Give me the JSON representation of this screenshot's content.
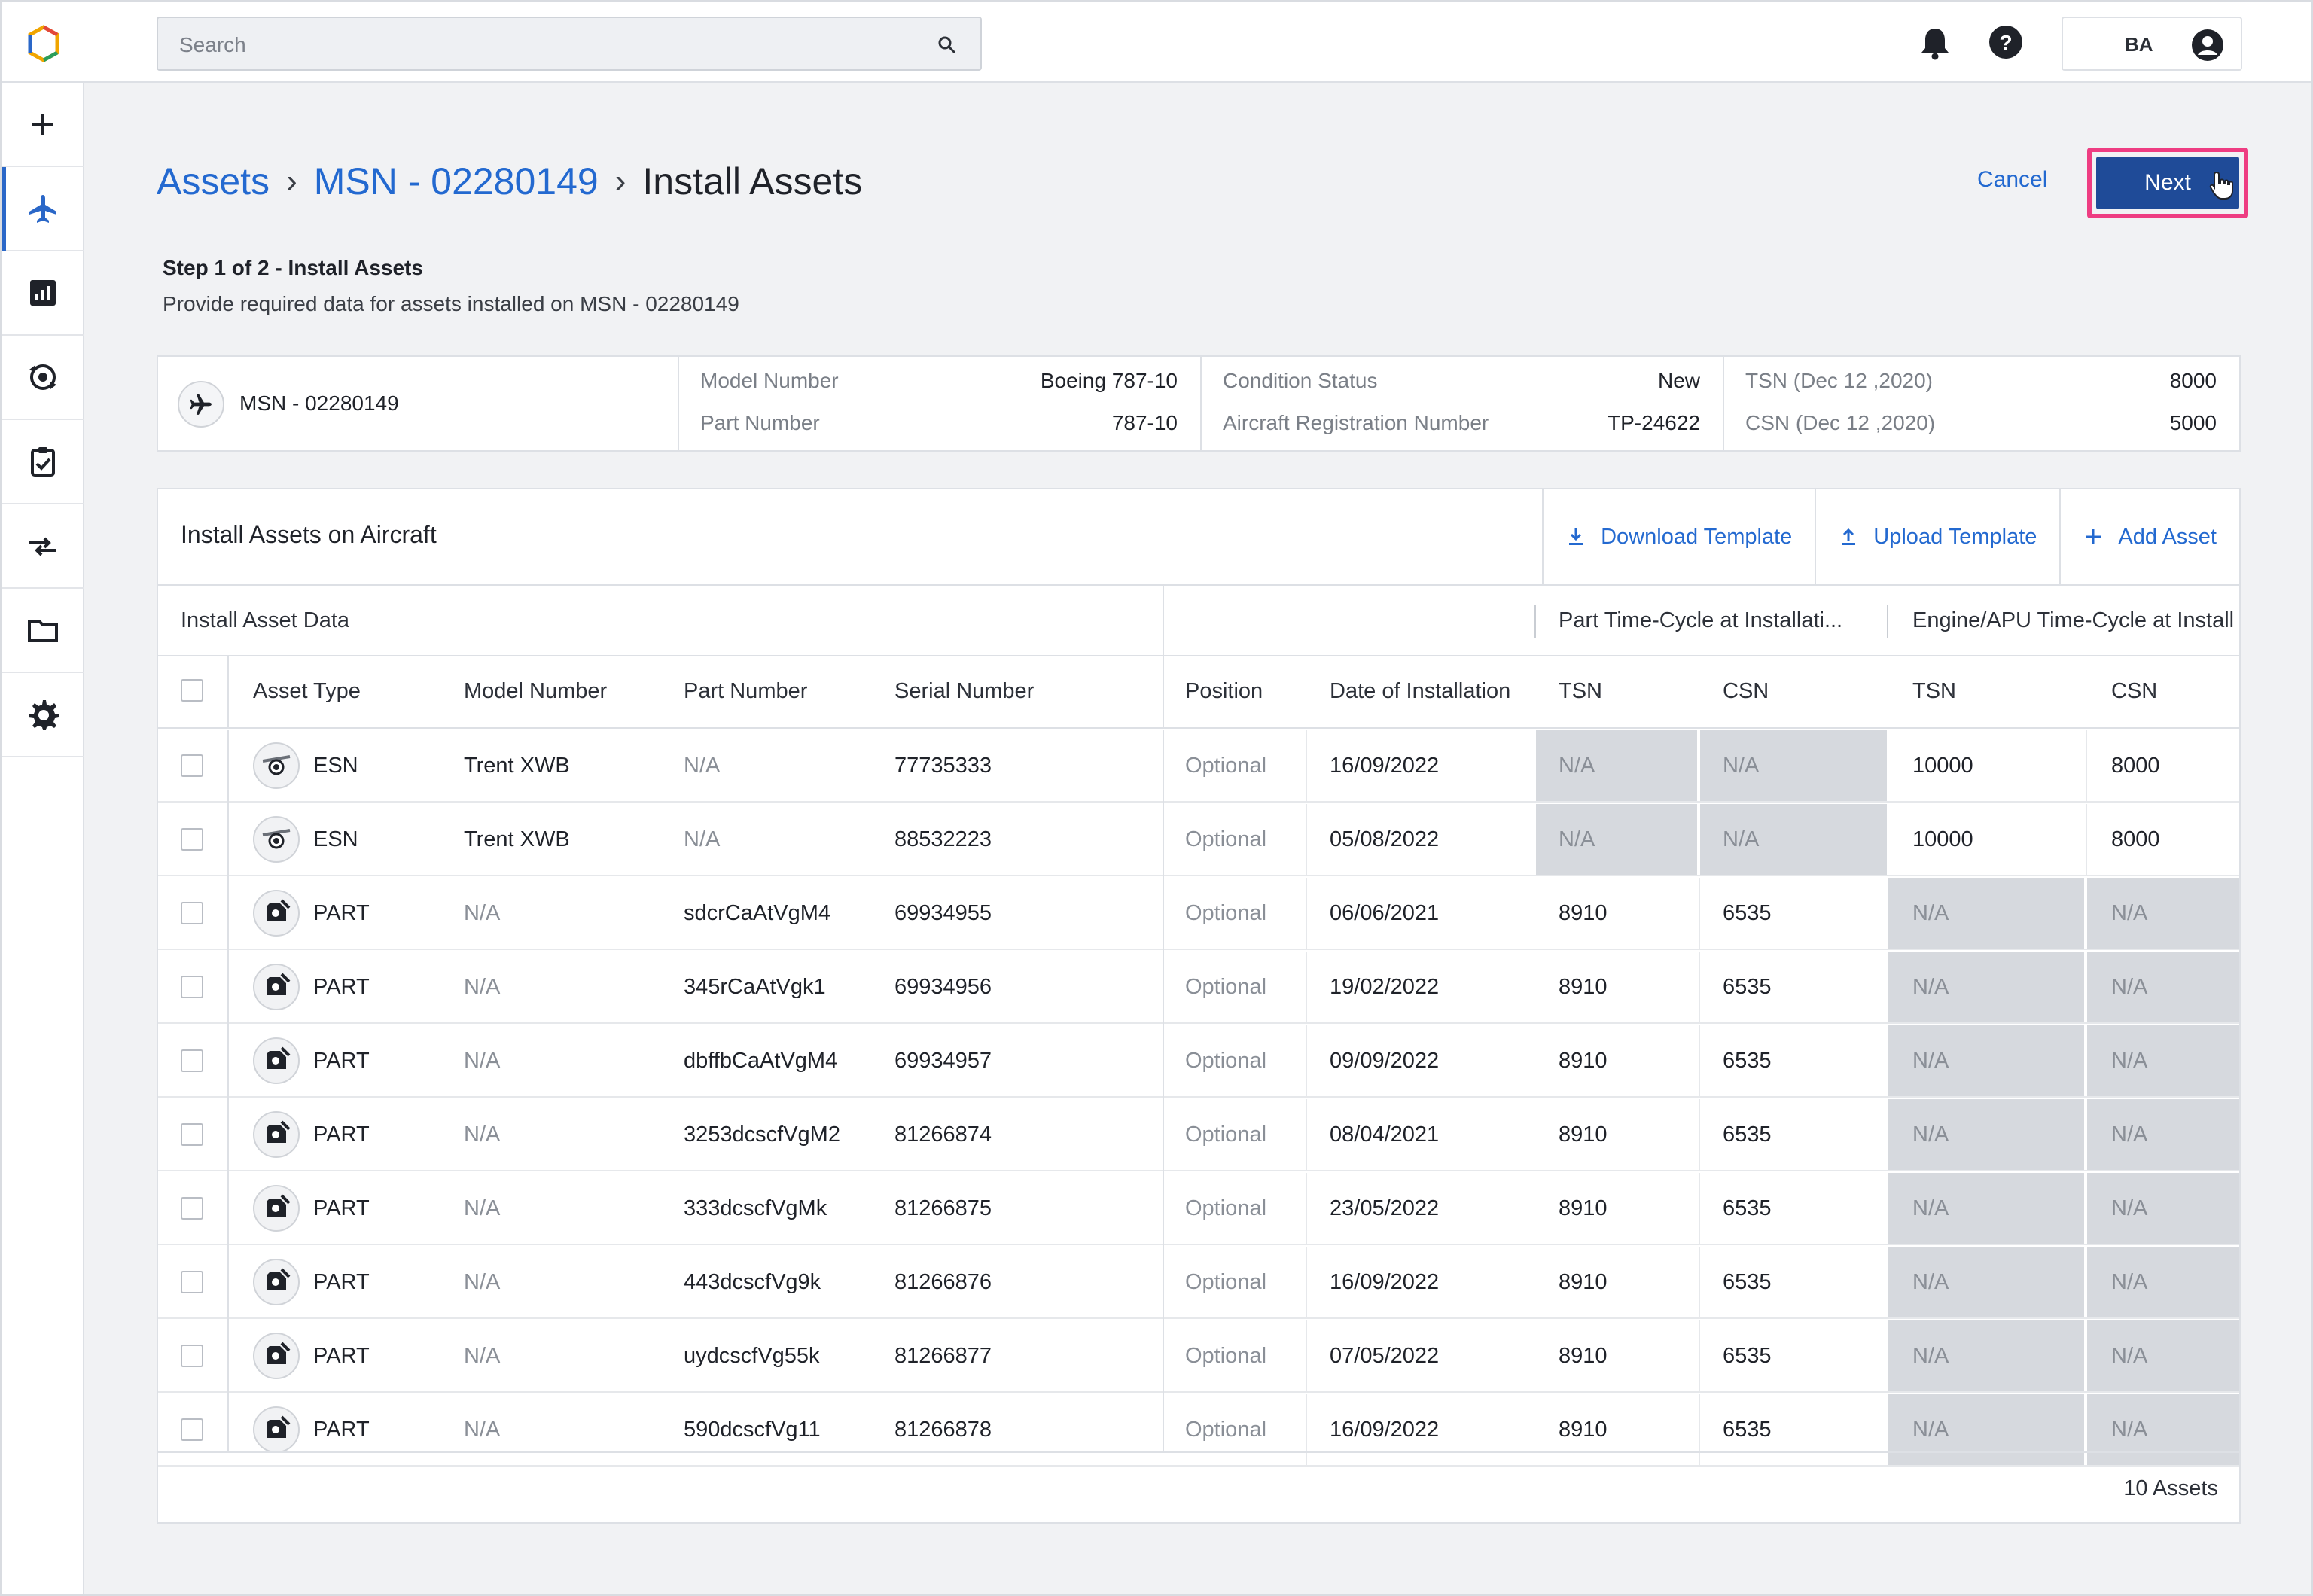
{
  "topbar": {
    "search_placeholder": "Search",
    "user_initials": "BA"
  },
  "sidenav": {
    "items": [
      "plus-icon",
      "airplane-icon",
      "analytics-icon",
      "maintenance-icon",
      "checklist-icon",
      "transfer-icon",
      "folder-icon",
      "settings-icon"
    ],
    "active": "airplane-icon"
  },
  "breadcrumb": {
    "root": "Assets",
    "parent": "MSN - 02280149",
    "current": "Install Assets",
    "separator": "›"
  },
  "actions": {
    "cancel": "Cancel",
    "next": "Next"
  },
  "step": {
    "title": "Step 1 of 2 - Install Assets",
    "description": "Provide required data for assets installed on MSN - 02280149"
  },
  "summary": {
    "msn": "MSN - 02280149",
    "model_number_label": "Model Number",
    "model_number": "Boeing 787-10",
    "part_number_label": "Part Number",
    "part_number": "787-10",
    "condition_label": "Condition Status",
    "condition": "New",
    "registration_label": "Aircraft Registration Number",
    "registration": "TP-24622",
    "tsn_label": "TSN (Dec 12 ,2020)",
    "tsn": "8000",
    "csn_label": "CSN (Dec 12 ,2020)",
    "csn": "5000"
  },
  "table": {
    "title": "Install Assets on Aircraft",
    "download": "Download Template",
    "upload": "Upload Template",
    "add": "Add Asset",
    "group_install": "Install Asset Data",
    "group_part": "Part Time-Cycle at Installati...",
    "group_engine": "Engine/APU Time-Cycle at Install",
    "headers": {
      "asset_type": "Asset Type",
      "model": "Model Number",
      "part": "Part Number",
      "serial": "Serial Number",
      "position": "Position",
      "date": "Date of Installation",
      "tsn": "TSN",
      "csn": "CSN",
      "eng_tsn": "TSN",
      "eng_csn": "CSN"
    },
    "rows": [
      {
        "type": "ESN",
        "icon": "engine-icon",
        "model": "Trent XWB",
        "part": "N/A",
        "serial": "77735333",
        "position": "Optional",
        "date": "16/09/2022",
        "tsn": "N/A",
        "csn": "N/A",
        "eng_tsn": "10000",
        "eng_csn": "8000"
      },
      {
        "type": "ESN",
        "icon": "engine-icon",
        "model": "Trent XWB",
        "part": "N/A",
        "serial": "88532223",
        "position": "Optional",
        "date": "05/08/2022",
        "tsn": "N/A",
        "csn": "N/A",
        "eng_tsn": "10000",
        "eng_csn": "8000"
      },
      {
        "type": "PART",
        "icon": "part-icon",
        "model": "N/A",
        "part": "sdcrCaAtVgM4",
        "serial": "69934955",
        "position": "Optional",
        "date": "06/06/2021",
        "tsn": "8910",
        "csn": "6535",
        "eng_tsn": "N/A",
        "eng_csn": "N/A"
      },
      {
        "type": "PART",
        "icon": "part-icon",
        "model": "N/A",
        "part": "345rCaAtVgk1",
        "serial": "69934956",
        "position": "Optional",
        "date": "19/02/2022",
        "tsn": "8910",
        "csn": "6535",
        "eng_tsn": "N/A",
        "eng_csn": "N/A"
      },
      {
        "type": "PART",
        "icon": "part-icon",
        "model": "N/A",
        "part": "dbffbCaAtVgM4",
        "serial": "69934957",
        "position": "Optional",
        "date": "09/09/2022",
        "tsn": "8910",
        "csn": "6535",
        "eng_tsn": "N/A",
        "eng_csn": "N/A"
      },
      {
        "type": "PART",
        "icon": "part-icon",
        "model": "N/A",
        "part": "3253dcscfVgM2",
        "serial": "81266874",
        "position": "Optional",
        "date": "08/04/2021",
        "tsn": "8910",
        "csn": "6535",
        "eng_tsn": "N/A",
        "eng_csn": "N/A"
      },
      {
        "type": "PART",
        "icon": "part-icon",
        "model": "N/A",
        "part": "333dcscfVgMk",
        "serial": "81266875",
        "position": "Optional",
        "date": "23/05/2022",
        "tsn": "8910",
        "csn": "6535",
        "eng_tsn": "N/A",
        "eng_csn": "N/A"
      },
      {
        "type": "PART",
        "icon": "part-icon",
        "model": "N/A",
        "part": "443dcscfVg9k",
        "serial": "81266876",
        "position": "Optional",
        "date": "16/09/2022",
        "tsn": "8910",
        "csn": "6535",
        "eng_tsn": "N/A",
        "eng_csn": "N/A"
      },
      {
        "type": "PART",
        "icon": "part-icon",
        "model": "N/A",
        "part": "uydcscfVg55k",
        "serial": "81266877",
        "position": "Optional",
        "date": "07/05/2022",
        "tsn": "8910",
        "csn": "6535",
        "eng_tsn": "N/A",
        "eng_csn": "N/A"
      },
      {
        "type": "PART",
        "icon": "part-icon",
        "model": "N/A",
        "part": "590dcscfVg11",
        "serial": "81266878",
        "position": "Optional",
        "date": "16/09/2022",
        "tsn": "8910",
        "csn": "6535",
        "eng_tsn": "N/A",
        "eng_csn": "N/A"
      }
    ],
    "footer": "10 Assets"
  },
  "colors": {
    "accent": "#2369d0",
    "primary_button": "#1f4b98",
    "highlight": "#ee3d82",
    "disabled_cell": "#d6d9de"
  }
}
